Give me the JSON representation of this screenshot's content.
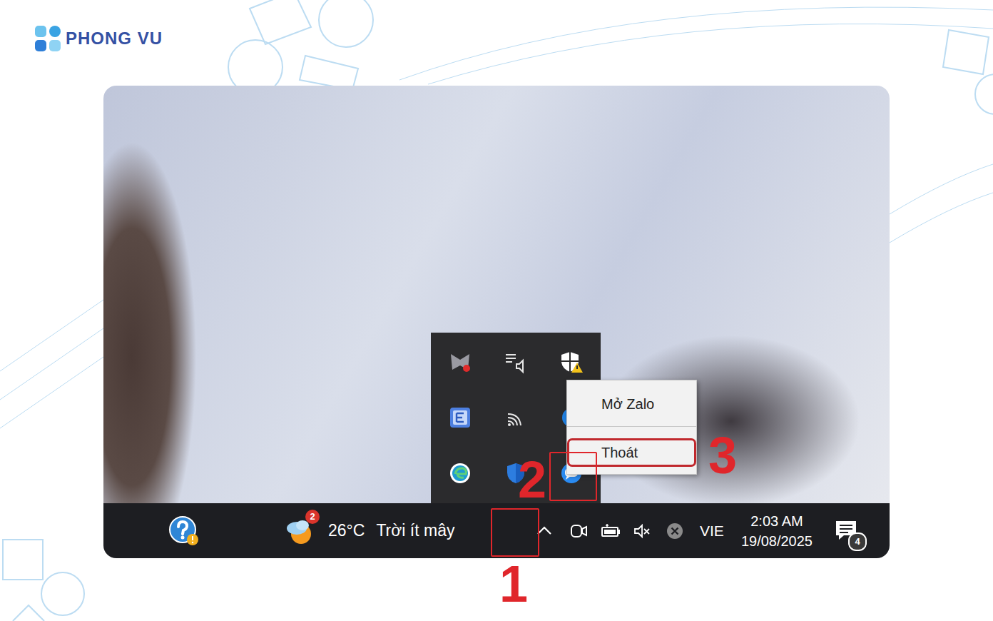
{
  "brand": {
    "name": "PHONG VU"
  },
  "taskbar": {
    "weather": {
      "badge": "2",
      "temperature": "26°C",
      "condition": "Trời ít mây"
    },
    "language": "VIE",
    "time": "2:03 AM",
    "date": "19/08/2025",
    "notifications": {
      "badge": "4"
    }
  },
  "tray_overflow": {
    "open": true
  },
  "context_menu": {
    "items": [
      {
        "label": "Mở Zalo",
        "highlighted": false
      },
      {
        "label": "Thoát",
        "highlighted": true
      }
    ]
  },
  "annotations": [
    {
      "label": "1",
      "target": "tray-chevron",
      "boxed": true
    },
    {
      "label": "2",
      "target": "zalo-tray-icon",
      "boxed": true
    },
    {
      "label": "3",
      "target": "exit-menu-item",
      "boxed": false
    }
  ]
}
